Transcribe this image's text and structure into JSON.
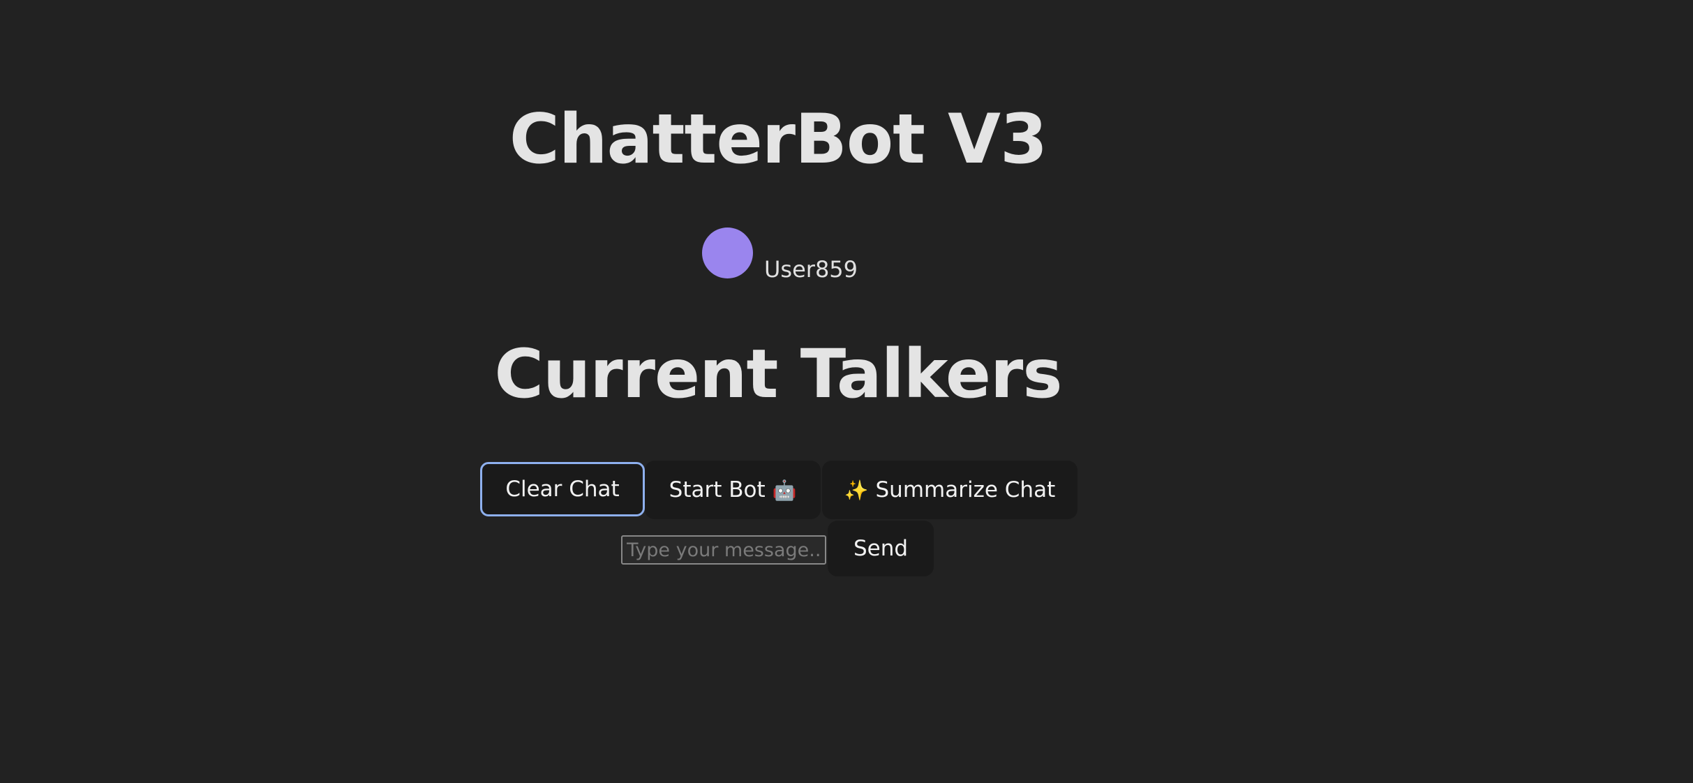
{
  "header": {
    "title": "ChatterBot V3"
  },
  "user": {
    "name": "User859",
    "avatar_color": "#9a85ee"
  },
  "talkers": {
    "heading": "Current Talkers"
  },
  "controls": {
    "clear_label": "Clear Chat",
    "start_label": "Start Bot",
    "start_icon": "🤖",
    "summarize_icon": "✨",
    "summarize_label": "Summarize Chat"
  },
  "composer": {
    "placeholder": "Type your message...",
    "value": "",
    "send_label": "Send"
  },
  "colors": {
    "background": "#222222",
    "button_bg": "#1a1a1a",
    "focus_ring": "#8eb0ee"
  }
}
